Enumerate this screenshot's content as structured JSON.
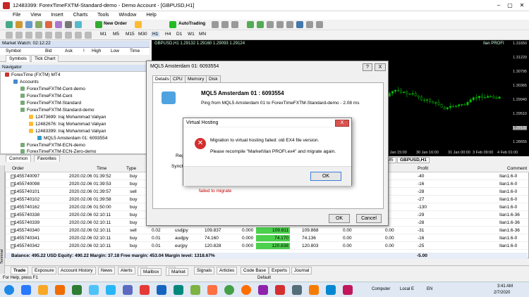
{
  "window": {
    "title": "12483399: ForexTimeFXTM-Standard-demo - Demo Account - [GBPUSD,H1]"
  },
  "menu": [
    "File",
    "View",
    "Insert",
    "Charts",
    "Tools",
    "Window",
    "Help"
  ],
  "toolbar": {
    "new_order": "New Order",
    "autotrading": "AutoTrading",
    "timeframes": [
      "M1",
      "M5",
      "M15",
      "M30",
      "H1",
      "H4",
      "D1",
      "W1",
      "MN"
    ]
  },
  "market_watch": {
    "title": "Market Watch: 02:12:22",
    "columns": [
      "Symbol",
      "Bid",
      "Ask",
      "!",
      "High",
      "Low",
      "Time"
    ],
    "tabs": [
      "Symbols",
      "Tick Chart"
    ]
  },
  "navigator": {
    "title": "Navigator",
    "root": "ForexTime (FXTM) MT4",
    "accounts_label": "Accounts",
    "items": [
      "ForexTimeFXTM-Cent-demo",
      "ForexTimeFXTM-Cent",
      "ForexTimeFXTM-Standard",
      "ForexTimeFXTM-Standard-demo",
      "12473699: Iraj Mohammad Valiyan",
      "12482676: Iraj Mohammad Valiyan",
      "12483399: Iraj Mohammad Valiyan",
      "MQL5 Amsterdam 01: 6093554",
      "ForexTimeFXTM-ECN-demo",
      "ForexTimeFXTM-ECN-Zero-demo"
    ],
    "tabs": [
      "Common",
      "Favorites"
    ]
  },
  "chart": {
    "title": "GBPUSD,H1  1.29132 1.29160 1.29093 1.29124",
    "right_label": "Ilan PROFI",
    "yticks": [
      "1.31650",
      "1.31220",
      "1.30795",
      "1.30365",
      "1.29940",
      "1.29510",
      "1.29132",
      "1.28655"
    ],
    "xticks": [
      "29 Jan 15:00",
      "30 Jan 16:00",
      "31 Jan 00:00",
      "3 Feb 09:00",
      "4 Feb 01:00"
    ]
  },
  "chart_tabs": [
    "HFJPY,M5",
    "GBPUSD,H1"
  ],
  "terminal": {
    "columns": [
      "Order",
      "Time",
      "Type",
      "Profit",
      "Comment"
    ],
    "rows": [
      {
        "order": "1455740097",
        "time": "2020.02.06 01:39:52",
        "type": "buy",
        "profit": "-40",
        "comment": "Ilan1.6-0"
      },
      {
        "order": "1455740098",
        "time": "2020.02.06 01:39:53",
        "type": "buy",
        "profit": "-16",
        "comment": "Ilan1.6-0"
      },
      {
        "order": "1455740101",
        "time": "2020.02.06 01:39:57",
        "type": "sell",
        "profit": "-28",
        "comment": "Ilan1.6-0"
      },
      {
        "order": "1455740102",
        "time": "2020.02.06 01:39:58",
        "type": "buy",
        "profit": "-27",
        "comment": "Ilan1.6-0"
      },
      {
        "order": "1455740162",
        "time": "2020.02.06 01:50:00",
        "type": "buy",
        "profit": "-130",
        "comment": "Ilan1.6-0"
      },
      {
        "order": "1455740338",
        "time": "2020.02.06 02:10:11",
        "type": "buy",
        "profit": "-29",
        "comment": "Ilan1.6-36"
      },
      {
        "order": "1455740339",
        "time": "2020.02.06 02:10:11",
        "type": "buy",
        "profit": "-28",
        "comment": "Ilan1.6-36"
      },
      {
        "order": "1455740340",
        "time": "2020.02.06 02:10:11",
        "type": "sell",
        "lots": "0.02",
        "symbol": "usdjpy",
        "price": "109.837",
        "sl": "0.000",
        "cur": "109.811",
        "tp": "109.868",
        "sw": "0.00",
        "cm": "0.00",
        "profit": "-31",
        "comment": "Ilan1.6-36"
      },
      {
        "order": "1455740341",
        "time": "2020.02.06 02:10:11",
        "type": "buy",
        "lots": "0.01",
        "symbol": "audjpy",
        "price": "74.160",
        "sl": "0.000",
        "cur": "74.170",
        "tp": "74.136",
        "sw": "0.00",
        "cm": "0.00",
        "profit": "-16",
        "comment": "Ilan1.6-0"
      },
      {
        "order": "1455740342",
        "time": "2020.02.06 02:10:11",
        "type": "buy",
        "lots": "0.01",
        "symbol": "eurjpy",
        "price": "120.828",
        "sl": "0.000",
        "cur": "120.838",
        "tp": "120.803",
        "sw": "0.00",
        "cm": "0.00",
        "profit": "-25",
        "comment": "Ilan1.6-0"
      }
    ],
    "balance": "Balance: 495.22 USD  Equity: 490.22  Margin: 37.18  Free margin: 453.04  Margin level: 1318.67%",
    "balance_profit": "-5.00",
    "tabs": [
      "Trade",
      "Exposure",
      "Account History",
      "News",
      "Alerts",
      "Mailbox",
      "Market",
      "Signals",
      "Articles",
      "Code Base",
      "Experts",
      "Journal"
    ],
    "mailbox_badge": "40",
    "market_badge": "68",
    "side_label": "Terminal"
  },
  "status": {
    "left": "For Help, press F1",
    "mid": "Default"
  },
  "taskbar": {
    "computer": "Computer",
    "local": "Local E",
    "lang": "EN",
    "time": "3:41 AM",
    "date": "2/7/2020"
  },
  "dialog": {
    "title": "MQL5 Amsterdam 01: 6093554",
    "tabs": [
      "Details",
      "CPU",
      "Memory",
      "Disk"
    ],
    "server_name": "MQL5 Amsterdam 01 : 6093554",
    "ping": "Ping from MQL5 Amsterdam 01 to ForexTimeFXTM-Standard-demo - 2.08 ms",
    "reg_label": "Regi",
    "sync_label": "Synchr",
    "failed": "failed to migrate",
    "ok": "OK",
    "cancel": "Cancel",
    "help": "?",
    "close": "X"
  },
  "vh_dialog": {
    "title": "Virtual Hosting",
    "line1": "Migration to virtual hosting failed: old EX4 file version.",
    "line2": "Please recompile \"Market\\Ilan PROFI.ex4\" and migrate again.",
    "ok": "OK",
    "close": "X"
  },
  "colors": {
    "chart_bg": "#000000",
    "candle_up": "#00c000",
    "dialog_error": "#d32f2f",
    "current_price": "#4bd14b"
  }
}
